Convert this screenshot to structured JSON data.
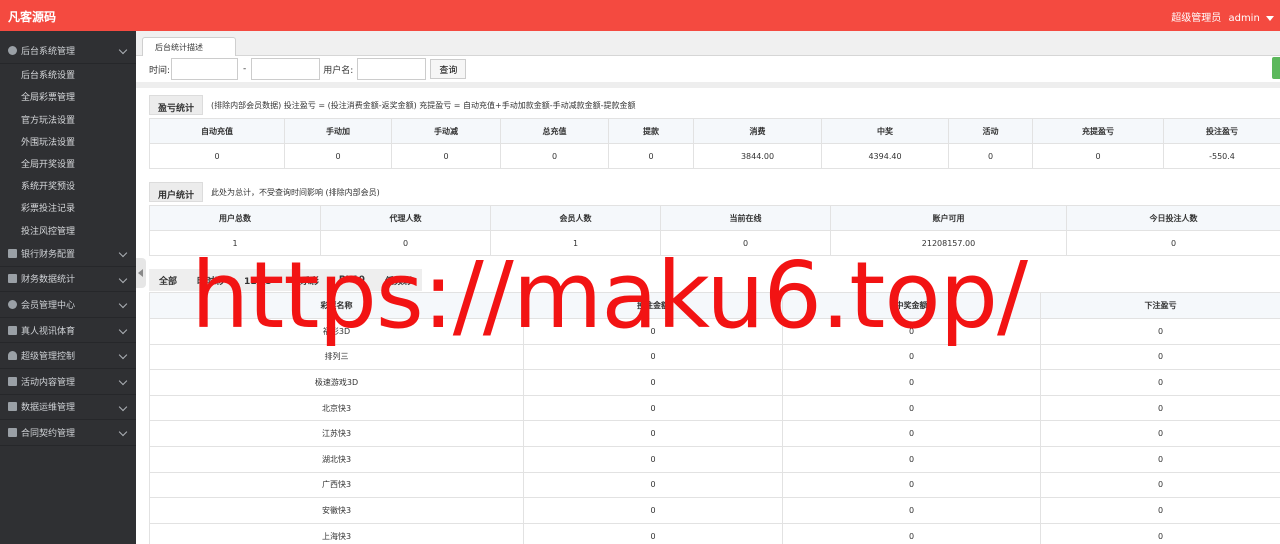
{
  "app": {
    "brand": "凡客源码",
    "user_role": "超级管理员",
    "user_name": "admin"
  },
  "sidebar": {
    "groups": [
      {
        "label": "后台系统管理",
        "icon": "gear-icon"
      },
      {
        "label": "银行财务配置",
        "icon": "bank-icon"
      },
      {
        "label": "财务数据统计",
        "icon": "chart-icon"
      },
      {
        "label": "会员管理中心",
        "icon": "users-icon"
      },
      {
        "label": "真人视讯体育",
        "icon": "video-icon"
      },
      {
        "label": "超级管理控制",
        "icon": "user-icon"
      },
      {
        "label": "活动内容管理",
        "icon": "list-icon"
      },
      {
        "label": "数据运维管理",
        "icon": "list-icon"
      },
      {
        "label": "合同契约管理",
        "icon": "list-icon"
      }
    ],
    "sub_items": [
      "后台系统设置",
      "全局彩票管理",
      "官方玩法设置",
      "外围玩法设置",
      "全局开奖设置",
      "系统开奖预设",
      "彩票投注记录",
      "投注风控管理"
    ]
  },
  "tabs": [
    {
      "label": "后台统计描述"
    }
  ],
  "filter": {
    "time_label": "时间:",
    "date_sep": "-",
    "username_label": "用户名:",
    "query_button": "查询"
  },
  "profit": {
    "title": "盈亏统计",
    "note": "(排除内部会员数据)  投注盈亏 = (投注消费金额-返奖金额)    充提盈亏 = 自动充值+手动加款金额-手动减款金额-提款金额",
    "headers": [
      "自动充值",
      "手动加",
      "手动减",
      "总充值",
      "提款",
      "消费",
      "中奖",
      "活动",
      "充提盈亏",
      "投注盈亏"
    ],
    "values": [
      "0",
      "0",
      "0",
      "0",
      "0",
      "3844.00",
      "4394.40",
      "0",
      "0",
      "-550.4"
    ]
  },
  "users": {
    "title": "用户统计",
    "note": "此处为总计，不受查询时间影响  (排除内部会员)",
    "headers": [
      "用户总数",
      "代理人数",
      "会员人数",
      "当前在线",
      "账户可用",
      "今日投注人数"
    ],
    "values": [
      "1",
      "0",
      "1",
      "0",
      "21208157.00",
      "0"
    ]
  },
  "lottery": {
    "tabs": [
      "全部",
      "时时彩",
      "11选5",
      "快乐彩",
      "PK10",
      "低频彩"
    ],
    "headers": [
      "彩票名称",
      "投注金额",
      "中奖金额",
      "下注盈亏"
    ],
    "rows": [
      {
        "name": "福彩3D",
        "bet": "0",
        "win": "0",
        "profit": "0"
      },
      {
        "name": "排列三",
        "bet": "0",
        "win": "0",
        "profit": "0"
      },
      {
        "name": "极速游戏3D",
        "bet": "0",
        "win": "0",
        "profit": "0"
      },
      {
        "name": "北京快3",
        "bet": "0",
        "win": "0",
        "profit": "0"
      },
      {
        "name": "江苏快3",
        "bet": "0",
        "win": "0",
        "profit": "0"
      },
      {
        "name": "湖北快3",
        "bet": "0",
        "win": "0",
        "profit": "0"
      },
      {
        "name": "广西快3",
        "bet": "0",
        "win": "0",
        "profit": "0"
      },
      {
        "name": "安徽快3",
        "bet": "0",
        "win": "0",
        "profit": "0"
      },
      {
        "name": "上海快3",
        "bet": "0",
        "win": "0",
        "profit": "0"
      }
    ]
  },
  "watermark": "https://maku6.top/",
  "colors": {
    "topbar": "#f44a40",
    "sidebar": "#2f3033",
    "watermark": "#f21313"
  }
}
